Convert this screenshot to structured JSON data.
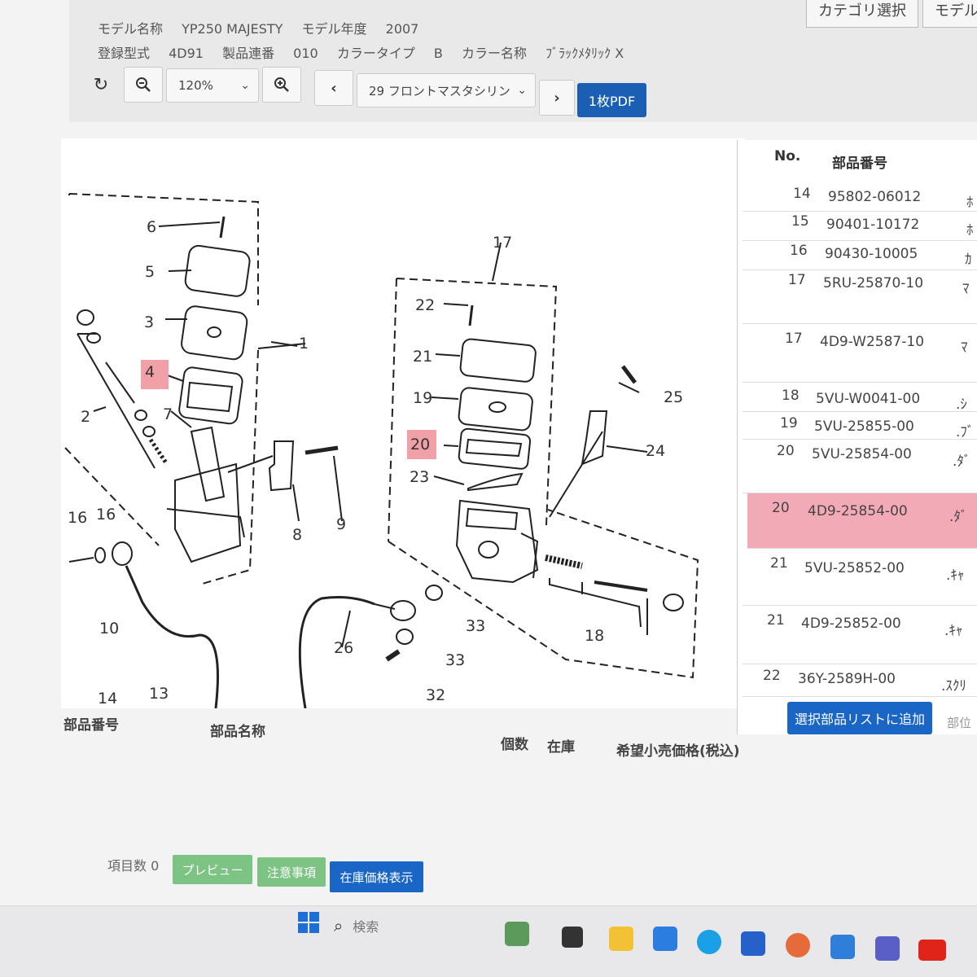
{
  "header": {
    "model_name_label": "モデル名称",
    "model_name": "YP250 MAJESTY",
    "model_year_label": "モデル年度",
    "model_year": "2007",
    "reg_type_label": "登録型式",
    "reg_type": "4D91",
    "serial_label": "製品連番",
    "serial": "010",
    "color_type_label": "カラータイプ",
    "color_type": "B",
    "color_name_label": "カラー名称",
    "color_name": "ﾌﾞﾗｯｸﾒﾀﾘｯｸ X",
    "tabs": [
      "カテゴリ選択",
      "モデル"
    ]
  },
  "toolbar": {
    "zoom": "120%",
    "figure_select": "29 フロントマスタシリン",
    "pdf_label": "1枚PDF"
  },
  "diagram": {
    "callouts": [
      "6",
      "5",
      "3",
      "4",
      "2",
      "7",
      "1",
      "16",
      "16",
      "8",
      "9",
      "10",
      "14",
      "13",
      "17",
      "22",
      "21",
      "19",
      "20",
      "23",
      "25",
      "24",
      "18",
      "33",
      "33",
      "26",
      "32"
    ]
  },
  "parts_table": {
    "headers": [
      "No.",
      "部品番号"
    ],
    "rows": [
      {
        "no": "14",
        "part": "95802-06012",
        "name": "ﾎ",
        "highlight": false
      },
      {
        "no": "15",
        "part": "90401-10172",
        "name": "ﾎ",
        "highlight": false
      },
      {
        "no": "16",
        "part": "90430-10005",
        "name": "ｶ",
        "highlight": false
      },
      {
        "no": "17",
        "part": "5RU-25870-10",
        "name": "ﾏ",
        "highlight": false
      },
      {
        "no": "17",
        "part": "4D9-W2587-10",
        "name": "ﾏ",
        "highlight": false
      },
      {
        "no": "18",
        "part": "5VU-W0041-00",
        "name": ".ｼ",
        "highlight": false
      },
      {
        "no": "19",
        "part": "5VU-25855-00",
        "name": ".ﾌﾞ",
        "highlight": false
      },
      {
        "no": "20",
        "part": "5VU-25854-00",
        "name": ".ﾀﾞ",
        "highlight": false
      },
      {
        "no": "20",
        "part": "4D9-25854-00",
        "name": ".ﾀﾞ",
        "highlight": true
      },
      {
        "no": "21",
        "part": "5VU-25852-00",
        "name": ".ｷｬ",
        "highlight": false
      },
      {
        "no": "21",
        "part": "4D9-25852-00",
        "name": ".ｷｬ",
        "highlight": false
      },
      {
        "no": "22",
        "part": "36Y-2589H-00",
        "name": ".ｽｸﾘ",
        "highlight": false
      }
    ],
    "add_button": "選択部品リストに追加",
    "side_label": "部位"
  },
  "selected_list": {
    "headers": [
      "部品番号",
      "部品名称",
      "個数",
      "在庫",
      "希望小売価格(税込)"
    ]
  },
  "footer": {
    "item_count_label": "項目数 0",
    "preview": "プレビュー",
    "notes": "注意事項",
    "stock_price": "在庫価格表示"
  },
  "taskbar": {
    "search_placeholder": "検索"
  }
}
